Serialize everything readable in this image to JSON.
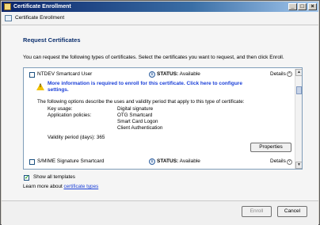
{
  "window": {
    "title": "Certificate Enrollment",
    "minimize": "_",
    "maximize": "□",
    "close": "×"
  },
  "nav": {
    "title": "Certificate Enrollment"
  },
  "main": {
    "heading": "Request Certificates",
    "intro": "You can request the following types of certificates. Select the certificates you want to request, and then click Enroll."
  },
  "certificates": [
    {
      "name": "NTDEV Smartcard User",
      "status_label": "STATUS:",
      "status_value": "Available",
      "details": "Details",
      "warning": "More information is required to enroll for this certificate. Click here to configure settings.",
      "warning_line1": "More information is required to enroll for this certificate. Click here to configure",
      "warning_line2": "settings.",
      "description": "The following options describe the uses and validity period that apply to this type of certificate:",
      "key_usage_label": "Key usage:",
      "key_usage_value": "Digital signature",
      "policies_label": "Application policies:",
      "policies": [
        "OTG Smartcard",
        "Smart Card Logon",
        "Client Authentication"
      ],
      "validity_label": "Validity period (days):",
      "validity_value": "365",
      "properties_button": "Properties"
    },
    {
      "name": "S/MIME Signature  Smartcard",
      "status_label": "STATUS:",
      "status_value": "Available",
      "details": "Details"
    }
  ],
  "show_all": {
    "label": "Show all templates",
    "checked": true
  },
  "learn_more": {
    "prefix": "Learn more about ",
    "link": "certificate types"
  },
  "footer": {
    "enroll": "Enroll",
    "cancel": "Cancel"
  },
  "colors": {
    "titlebar_start": "#0a246a",
    "link": "#1a3fd8",
    "heading": "#0b2f6e",
    "warning": "#f2c200"
  }
}
